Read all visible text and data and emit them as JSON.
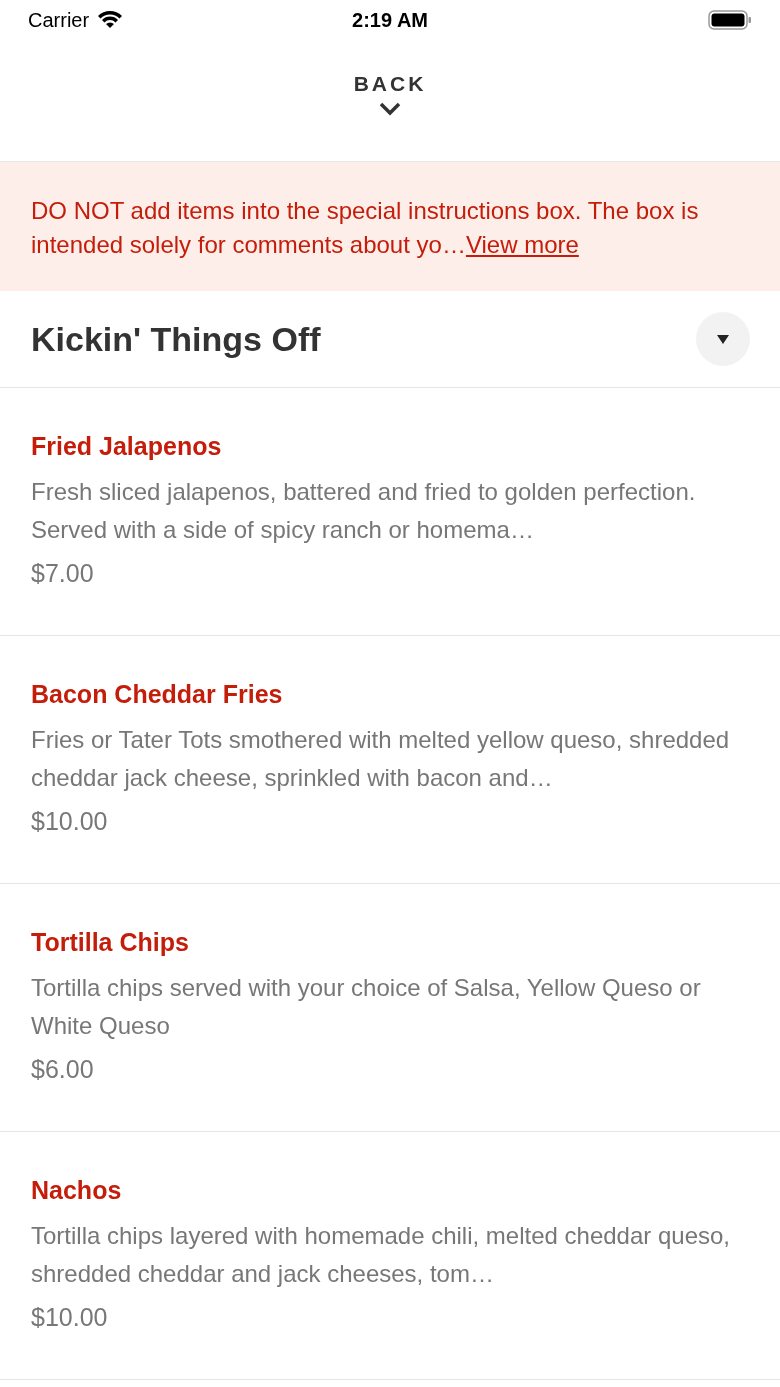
{
  "status_bar": {
    "carrier": "Carrier",
    "time": "2:19 AM"
  },
  "header": {
    "back_label": "BACK"
  },
  "notice": {
    "text": "DO NOT add items into the special instructions box. The box is intended solely for comments about yo…",
    "link": "View more"
  },
  "section": {
    "title": "Kickin' Things Off"
  },
  "items": [
    {
      "name": "Fried Jalapenos",
      "description": "Fresh sliced jalapenos, battered and fried to golden perfection. Served with a side of spicy ranch or homema…",
      "price": "$7.00"
    },
    {
      "name": "Bacon Cheddar Fries",
      "description": "Fries or Tater Tots smothered with melted yellow queso, shredded cheddar jack cheese, sprinkled with bacon and…",
      "price": "$10.00"
    },
    {
      "name": "Tortilla Chips",
      "description": "Tortilla chips served with your choice of Salsa, Yellow Queso or White Queso",
      "price": "$6.00"
    },
    {
      "name": "Nachos",
      "description": "Tortilla chips layered with homemade chili, melted cheddar queso, shredded cheddar and jack cheeses, tom…",
      "price": "$10.00"
    }
  ]
}
